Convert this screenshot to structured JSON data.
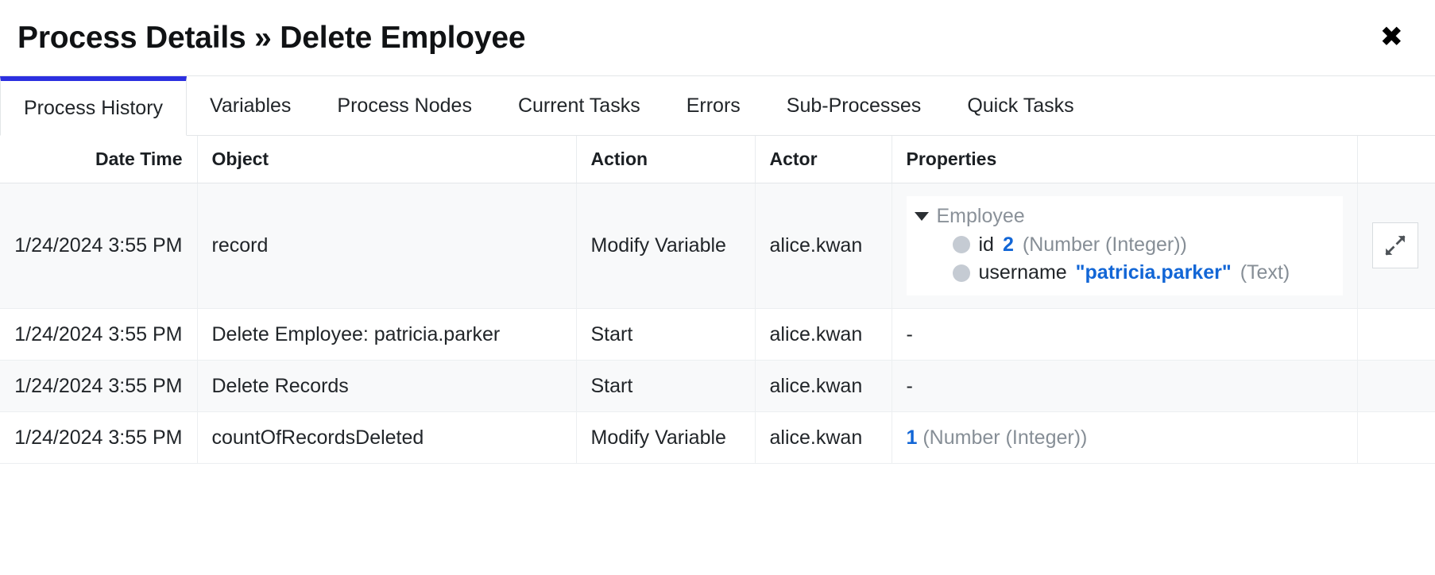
{
  "header": {
    "title": "Process Details » Delete Employee",
    "close_label": "✖"
  },
  "tabs": [
    {
      "label": "Process History",
      "active": true
    },
    {
      "label": "Variables",
      "active": false
    },
    {
      "label": "Process Nodes",
      "active": false
    },
    {
      "label": "Current Tasks",
      "active": false
    },
    {
      "label": "Errors",
      "active": false
    },
    {
      "label": "Sub-Processes",
      "active": false
    },
    {
      "label": "Quick Tasks",
      "active": false
    }
  ],
  "table": {
    "columns": [
      "Date Time",
      "Object",
      "Action",
      "Actor",
      "Properties",
      ""
    ],
    "rows": [
      {
        "date_time": "1/24/2024 3:55 PM",
        "object": "record",
        "action": "Modify Variable",
        "actor": "alice.kwan",
        "properties_kind": "tree",
        "tree": {
          "root_label": "Employee",
          "children": [
            {
              "key": "id",
              "value": "2",
              "type": "(Number (Integer))"
            },
            {
              "key": "username",
              "value": "\"patricia.parker\"",
              "type": "(Text)"
            }
          ]
        },
        "has_expand_button": true
      },
      {
        "date_time": "1/24/2024 3:55 PM",
        "object": "Delete Employee: patricia.parker",
        "action": "Start",
        "actor": "alice.kwan",
        "properties_kind": "dash",
        "properties_text": "-",
        "has_expand_button": false
      },
      {
        "date_time": "1/24/2024 3:55 PM",
        "object": "Delete Records",
        "action": "Start",
        "actor": "alice.kwan",
        "properties_kind": "dash",
        "properties_text": "-",
        "has_expand_button": false
      },
      {
        "date_time": "1/24/2024 3:55 PM",
        "object": "countOfRecordsDeleted",
        "action": "Modify Variable",
        "actor": "alice.kwan",
        "properties_kind": "value",
        "value": "1",
        "value_type": "(Number (Integer))",
        "has_expand_button": false
      }
    ]
  },
  "colors": {
    "accent": "#2c30e0",
    "value_blue": "#1266d6",
    "muted": "#868e96",
    "row_stripe": "#f8f9fa"
  }
}
